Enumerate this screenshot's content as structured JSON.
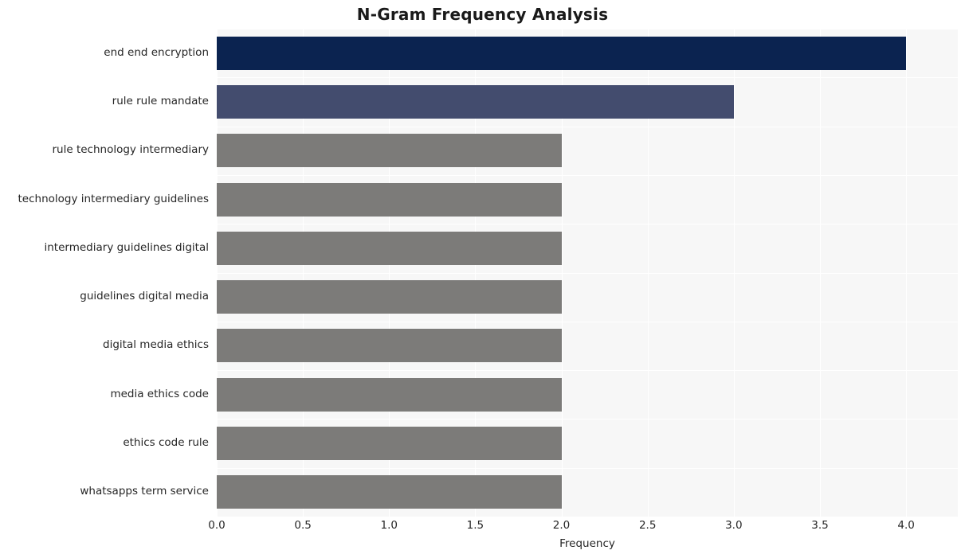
{
  "chart_data": {
    "type": "bar",
    "orientation": "horizontal",
    "title": "N-Gram Frequency Analysis",
    "xlabel": "Frequency",
    "ylabel": "",
    "xlim": [
      0,
      4.3
    ],
    "xticks": [
      "0.0",
      "0.5",
      "1.0",
      "1.5",
      "2.0",
      "2.5",
      "3.0",
      "3.5",
      "4.0"
    ],
    "xtick_values": [
      0.0,
      0.5,
      1.0,
      1.5,
      2.0,
      2.5,
      3.0,
      3.5,
      4.0
    ],
    "grid": true,
    "legend": "none",
    "categories": [
      "end end encryption",
      "rule rule mandate",
      "rule technology intermediary",
      "technology intermediary guidelines",
      "intermediary guidelines digital",
      "guidelines digital media",
      "digital media ethics",
      "media ethics code",
      "ethics code rule",
      "whatsapps term service"
    ],
    "values": [
      4,
      3,
      2,
      2,
      2,
      2,
      2,
      2,
      2,
      2
    ],
    "bar_colors": [
      "#0b2350",
      "#434c6e",
      "#7c7b79",
      "#7c7b79",
      "#7c7b79",
      "#7c7b79",
      "#7c7b79",
      "#7c7b79",
      "#7c7b79",
      "#7c7b79"
    ],
    "plot_background": "#f7f7f7",
    "page_background": "#ffffff",
    "grid_color": "#ffffff"
  }
}
